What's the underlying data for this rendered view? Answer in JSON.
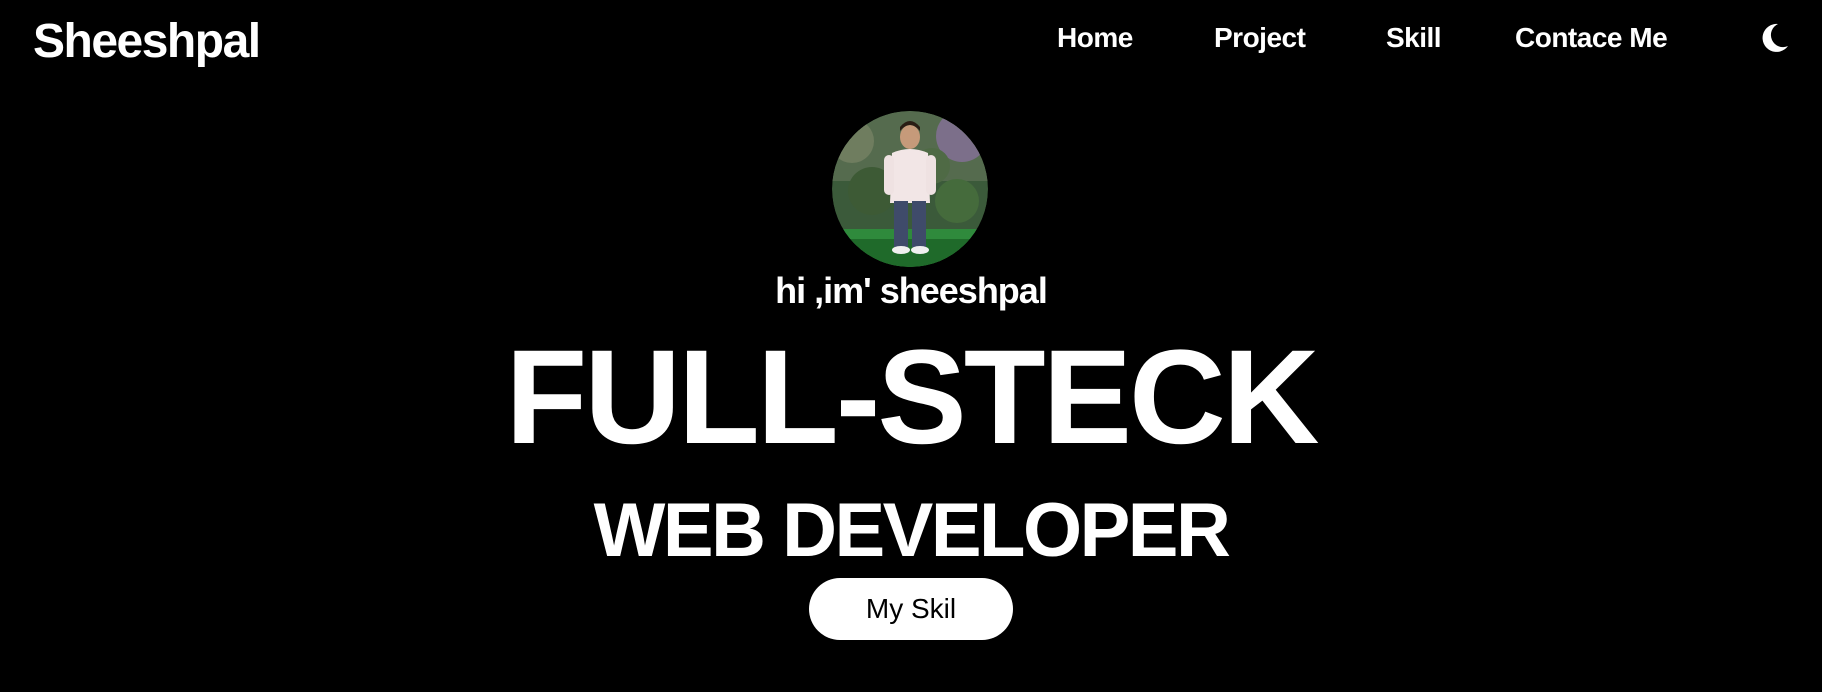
{
  "navbar": {
    "brand": "Sheeshpal",
    "links": [
      {
        "label": "Home"
      },
      {
        "label": "Project"
      },
      {
        "label": "Skill"
      },
      {
        "label": "Contace Me"
      }
    ],
    "theme_toggle_icon": "moon-icon"
  },
  "hero": {
    "avatar_icon": "profile-photo",
    "greeting": "hi ,im' sheeshpal",
    "headline": "FULL-STECK",
    "subheadline": "WEB DEVELOPER",
    "cta_label": "My Skil"
  },
  "colors": {
    "background": "#000000",
    "text": "#ffffff",
    "button_background": "#ffffff",
    "button_text": "#000000"
  }
}
